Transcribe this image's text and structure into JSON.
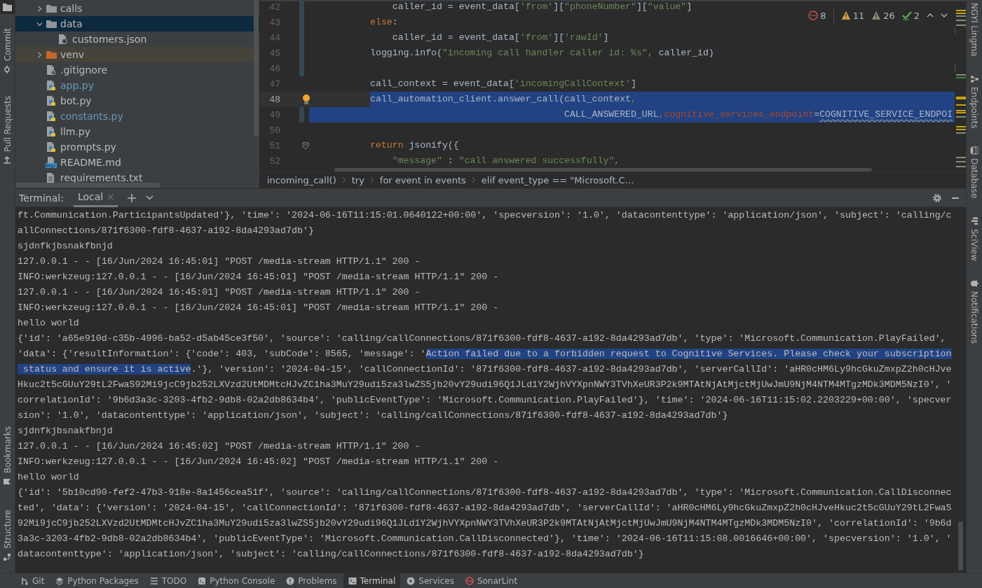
{
  "left_strip": {
    "items": [
      {
        "label": "Commit"
      },
      {
        "label": "Pull Requests"
      },
      {
        "label": "Bookmarks"
      },
      {
        "label": "Structure"
      }
    ]
  },
  "project_tree": {
    "items": [
      {
        "name": "calls",
        "kind": "folder",
        "expanded": false,
        "selected": false,
        "modified": false
      },
      {
        "name": "data",
        "kind": "folder",
        "expanded": true,
        "selected": true,
        "modified": false,
        "children": [
          {
            "name": "customers.json",
            "kind": "json",
            "selected": false,
            "modified": false
          }
        ]
      },
      {
        "name": "venv",
        "kind": "excluded-folder",
        "expanded": false,
        "selected": false,
        "modified": false
      },
      {
        "name": ".gitignore",
        "kind": "ignore",
        "selected": false,
        "modified": false
      },
      {
        "name": "app.py",
        "kind": "python",
        "selected": false,
        "modified": true
      },
      {
        "name": "bot.py",
        "kind": "python",
        "selected": false,
        "modified": false
      },
      {
        "name": "constants.py",
        "kind": "python",
        "selected": false,
        "modified": true
      },
      {
        "name": "llm.py",
        "kind": "python",
        "selected": false,
        "modified": false
      },
      {
        "name": "prompts.py",
        "kind": "python",
        "selected": false,
        "modified": false
      },
      {
        "name": "README.md",
        "kind": "markdown",
        "selected": false,
        "modified": false
      },
      {
        "name": "requirements.txt",
        "kind": "text",
        "selected": false,
        "modified": false
      }
    ]
  },
  "editor": {
    "inspections": [
      {
        "kind": "error",
        "count": "8"
      },
      {
        "kind": "warning",
        "count": "11"
      },
      {
        "kind": "weak-warning",
        "count": "26"
      },
      {
        "kind": "typo",
        "count": "2"
      }
    ],
    "lines": [
      {
        "number": "42",
        "kind": "code",
        "changed": true,
        "current": false,
        "segments": [
          {
            "text": "               caller_id = event_data[",
            "kind": "plain",
            "selected": false
          },
          {
            "text": "'from'",
            "kind": "string",
            "selected": false
          },
          {
            "text": "][",
            "kind": "plain",
            "selected": false
          },
          {
            "text": "\"phoneNumber\"",
            "kind": "string",
            "selected": false
          },
          {
            "text": "][",
            "kind": "plain",
            "selected": false
          },
          {
            "text": "\"value\"",
            "kind": "string",
            "selected": false
          },
          {
            "text": "]",
            "kind": "plain",
            "selected": false
          }
        ]
      },
      {
        "number": "43",
        "kind": "code",
        "changed": true,
        "current": false,
        "segments": [
          {
            "text": "           else",
            "kind": "keyword",
            "selected": false
          },
          {
            "text": ":",
            "kind": "plain",
            "selected": false
          }
        ]
      },
      {
        "number": "44",
        "kind": "code",
        "changed": true,
        "current": false,
        "segments": [
          {
            "text": "               caller_id = event_data[",
            "kind": "plain",
            "selected": false
          },
          {
            "text": "'from'",
            "kind": "string",
            "selected": false
          },
          {
            "text": "][",
            "kind": "plain",
            "selected": false
          },
          {
            "text": "'rawId'",
            "kind": "string",
            "selected": false
          },
          {
            "text": "]",
            "kind": "plain",
            "selected": false
          }
        ]
      },
      {
        "number": "45",
        "kind": "code",
        "changed": true,
        "current": false,
        "segments": [
          {
            "text": "           logging.info(",
            "kind": "plain",
            "selected": false
          },
          {
            "text": "\"incoming call handler caller id: %s\"",
            "kind": "string",
            "selected": false
          },
          {
            "text": ",",
            "kind": "keyword",
            "selected": false
          },
          {
            "text": " caller_id)",
            "kind": "plain",
            "selected": false
          }
        ]
      },
      {
        "number": "46",
        "kind": "code",
        "changed": true,
        "current": false
      },
      {
        "number": "47",
        "kind": "code",
        "changed": false,
        "current": false,
        "segments": [
          {
            "text": "           call_context = event_data[",
            "kind": "plain",
            "selected": false
          },
          {
            "text": "'incomingCallContext'",
            "kind": "string",
            "selected": false
          },
          {
            "text": "]",
            "kind": "plain",
            "selected": false
          }
        ]
      },
      {
        "number": "48",
        "kind": "bulb",
        "changed": false,
        "current": true,
        "segments": [
          {
            "text": "           call_automation_client.answer_call(call_context",
            "kind": "plain",
            "selected": true
          },
          {
            "text": ",",
            "kind": "keyword",
            "selected": true
          }
        ]
      },
      {
        "number": "49",
        "kind": "code",
        "changed": true,
        "current": false,
        "segments": [
          {
            "text": "                                              CALL_ANSWERED_URL",
            "kind": "plain",
            "selected": true
          },
          {
            "text": ",",
            "kind": "keyword",
            "selected": true
          },
          {
            "text": "cognitive_services_endpoint",
            "kind": "param",
            "selected": true
          },
          {
            "text": "=",
            "kind": "plain",
            "selected": true
          },
          {
            "text": "COGNITIVE_SERVICE_ENDPOI",
            "kind": "flagged",
            "selected": true
          }
        ]
      },
      {
        "number": "50",
        "kind": "code",
        "changed": false,
        "current": false
      },
      {
        "number": "51",
        "kind": "fold",
        "changed": false,
        "current": false,
        "segments": [
          {
            "text": "           return",
            "kind": "keyword",
            "selected": false
          },
          {
            "text": " jsonify({",
            "kind": "plain",
            "selected": false
          }
        ]
      },
      {
        "number": "52",
        "kind": "code",
        "changed": false,
        "current": false,
        "segments": [
          {
            "text": "               \"message\"",
            "kind": "string",
            "selected": false
          },
          {
            "text": " : ",
            "kind": "plain",
            "selected": false
          },
          {
            "text": "\"call answered successfully\"",
            "kind": "string",
            "selected": false
          },
          {
            "text": ",",
            "kind": "keyword",
            "selected": false
          }
        ]
      }
    ],
    "breadcrumbs": [
      "incoming_call()",
      "try",
      "for event in events",
      "elif event_type == \"Microsoft.C…"
    ]
  },
  "terminal": {
    "title": "Terminal:",
    "tabs": [
      {
        "label": "Local",
        "selected": true
      }
    ],
    "lines": [
      [
        {
          "text": "ft.Communication.ParticipantsUpdated'}, 'time': '2024-06-16T11:15:01.0640122+00:00', 'specversion': '1.0', 'datacontenttype': 'application/json', 'subject': 'calling/c",
          "selected": false
        }
      ],
      [
        {
          "text": "allConnections/871f6300-fdf8-4637-a192-8da4293ad7db'}",
          "selected": false
        }
      ],
      [
        {
          "text": "sjdnfkjbsnakfbnjd",
          "selected": false
        }
      ],
      [
        {
          "text": "127.0.0.1 - - [16/Jun/2024 16:45:01] \"POST /media-stream HTTP/1.1\" 200 -",
          "selected": false
        }
      ],
      [
        {
          "text": "INFO:werkzeug:127.0.0.1 - - [16/Jun/2024 16:45:01] \"POST /media-stream HTTP/1.1\" 200 -",
          "selected": false
        }
      ],
      [
        {
          "text": "127.0.0.1 - - [16/Jun/2024 16:45:01] \"POST /media-stream HTTP/1.1\" 200 -",
          "selected": false
        }
      ],
      [
        {
          "text": "INFO:werkzeug:127.0.0.1 - - [16/Jun/2024 16:45:01] \"POST /media-stream HTTP/1.1\" 200 -",
          "selected": false
        }
      ],
      [
        {
          "text": "hello world",
          "selected": false
        }
      ],
      [
        {
          "text": "{'id': 'a65e910d-c35b-4996-ba52-d5ab45ce3f50', 'source': 'calling/callConnections/871f6300-fdf8-4637-a192-8da4293ad7db', 'type': 'Microsoft.Communication.PlayFailed',",
          "selected": false
        }
      ],
      [
        {
          "text": "'data': {'resultInformation': {'code': 403, 'subCode': 8565, 'message': '",
          "selected": false
        },
        {
          "text": "Action failed due to a forbidden request to Cognitive Services. Please check your subscription",
          "selected": true
        }
      ],
      [
        {
          "text": " status and ensure it is active",
          "selected": true
        },
        {
          "text": ".'}, 'version': '2024-04-15', 'callConnectionId': '871f6300-fdf8-4637-a192-8da4293ad7db', 'serverCallId': 'aHR0cHM6Ly9hcGkuZmxpZ2h0cHJve",
          "selected": false
        }
      ],
      [
        {
          "text": "Hkuc2t5cGUuY29tL2FwaS92Mi9jcC9jb252LXVzd2UtMDMtcHJvZC1ha3MuY29udi5za3lwZS5jb20vY29udi96Q1JLd1Y2WjhVYXpnNWY3TVhXeUR3P2k9MTAtNjAtMjctMjUwJmU9NjM4NTM4MTgzMDk3MDM5NzI0', '",
          "selected": false
        }
      ],
      [
        {
          "text": "correlationId': '9b6d3a3c-3203-4fb2-9db8-02a2db8634b4', 'publicEventType': 'Microsoft.Communication.PlayFailed'}, 'time': '2024-06-16T11:15:02.2203229+00:00', 'specver",
          "selected": false
        }
      ],
      [
        {
          "text": "sion': '1.0', 'datacontenttype': 'application/json', 'subject': 'calling/callConnections/871f6300-fdf8-4637-a192-8da4293ad7db'}",
          "selected": false
        }
      ],
      [
        {
          "text": "sjdnfkjbsnakfbnjd",
          "selected": false
        }
      ],
      [
        {
          "text": "127.0.0.1 - - [16/Jun/2024 16:45:02] \"POST /media-stream HTTP/1.1\" 200 -",
          "selected": false
        }
      ],
      [
        {
          "text": "INFO:werkzeug:127.0.0.1 - - [16/Jun/2024 16:45:02] \"POST /media-stream HTTP/1.1\" 200 -",
          "selected": false
        }
      ],
      [
        {
          "text": "hello world",
          "selected": false
        }
      ],
      [
        {
          "text": "{'id': '5b10cd90-fef2-47b3-918e-8a1456cea51f', 'source': 'calling/callConnections/871f6300-fdf8-4637-a192-8da4293ad7db', 'type': 'Microsoft.Communication.CallDisconnec",
          "selected": false
        }
      ],
      [
        {
          "text": "ted', 'data': {'version': '2024-04-15', 'callConnectionId': '871f6300-fdf8-4637-a192-8da4293ad7db', 'serverCallId': 'aHR0cHM6Ly9hcGkuZmxpZ2h0cHJveHkuc2t5cGUuY29tL2FwaS",
          "selected": false
        }
      ],
      [
        {
          "text": "92Mi9jcC9jb252LXVzd2UtMDMtcHJvZC1ha3MuY29udi5za3lwZS5jb20vY29udi96Q1JLd1Y2WjhVYXpnNWY3TVhXeUR3P2k9MTAtNjAtMjctMjUwJmU9NjM4NTM4MTgzMDk3MDM5NzI0', 'correlationId': '9b6d",
          "selected": false
        }
      ],
      [
        {
          "text": "3a3c-3203-4fb2-9db8-02a2db8634b4', 'publicEventType': 'Microsoft.Communication.CallDisconnected'}, 'time': '2024-06-16T11:15:08.0016646+00:00', 'specversion': '1.0', '",
          "selected": false
        }
      ],
      [
        {
          "text": "datacontenttype': 'application/json', 'subject': 'calling/callConnections/871f6300-fdf8-4637-a192-8da4293ad7db'}",
          "selected": false
        }
      ]
    ]
  },
  "right_strip": {
    "items": [
      {
        "label": "NGYI Lingma"
      },
      {
        "label": "Endpoints"
      },
      {
        "label": "Database"
      },
      {
        "label": "SciView"
      },
      {
        "label": "Notifications"
      }
    ]
  },
  "bottom_bar": {
    "tools": [
      {
        "label": "Git",
        "selected": false
      },
      {
        "label": "Python Packages",
        "selected": false
      },
      {
        "label": "TODO",
        "selected": false
      },
      {
        "label": "Python Console",
        "selected": false
      },
      {
        "label": "Problems",
        "selected": false
      },
      {
        "label": "Terminal",
        "selected": true
      },
      {
        "label": "Services",
        "selected": false
      },
      {
        "label": "SonarLint",
        "selected": false
      }
    ]
  }
}
